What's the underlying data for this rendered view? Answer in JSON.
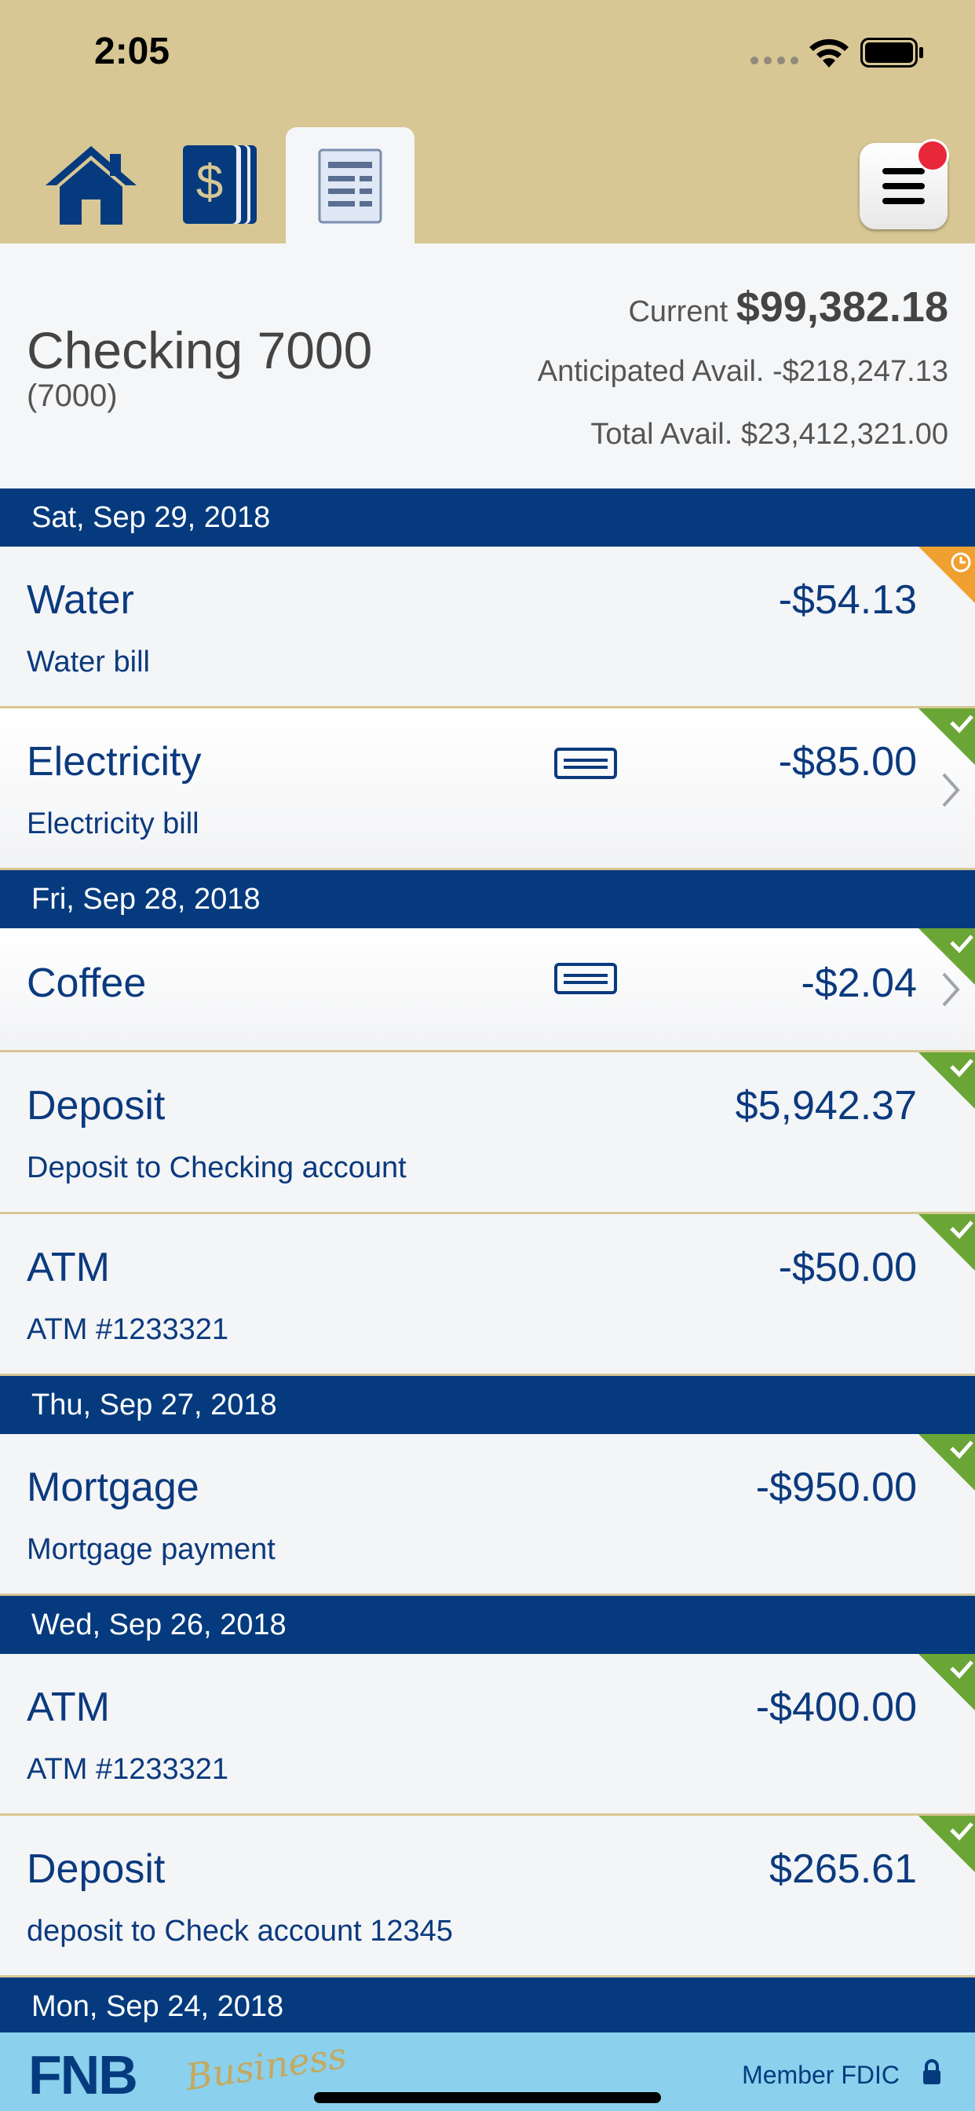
{
  "status_bar": {
    "time": "2:05"
  },
  "nav": {
    "tabs": [
      {
        "name": "home",
        "icon": "house-icon"
      },
      {
        "name": "accounts",
        "icon": "dollar-cards-icon"
      },
      {
        "name": "register",
        "icon": "register-list-icon",
        "selected": true
      }
    ],
    "menu_icon": "hamburger-menu-icon",
    "notification_badge": true
  },
  "account": {
    "name": "Checking 7000",
    "number": "(7000)",
    "current_label": "Current",
    "current_amount": "$99,382.18",
    "anticipated_label": "Anticipated Avail.",
    "anticipated_amount": "-$218,247.13",
    "total_label": "Total Avail.",
    "total_amount": "$23,412,321.00"
  },
  "groups": [
    {
      "date": "Sat, Sep 29, 2018",
      "items": [
        {
          "payee": "Water",
          "memo": "Water bill",
          "amount": "-$54.13",
          "status": "pending",
          "card": false,
          "chevron": false
        },
        {
          "payee": "Electricity",
          "memo": "Electricity bill",
          "amount": "-$85.00",
          "status": "cleared",
          "card": true,
          "chevron": true
        }
      ]
    },
    {
      "date": "Fri, Sep 28, 2018",
      "items": [
        {
          "payee": "Coffee",
          "memo": "",
          "amount": "-$2.04",
          "status": "cleared",
          "card": true,
          "chevron": true
        },
        {
          "payee": "Deposit",
          "memo": "Deposit to Checking account",
          "amount": "$5,942.37",
          "status": "cleared",
          "card": false,
          "chevron": false
        },
        {
          "payee": "ATM",
          "memo": "ATM #1233321",
          "amount": "-$50.00",
          "status": "cleared",
          "card": false,
          "chevron": false
        }
      ]
    },
    {
      "date": "Thu, Sep 27, 2018",
      "items": [
        {
          "payee": "Mortgage",
          "memo": "Mortgage payment",
          "amount": "-$950.00",
          "status": "cleared",
          "card": false,
          "chevron": false
        }
      ]
    },
    {
      "date": "Wed, Sep 26, 2018",
      "items": [
        {
          "payee": "ATM",
          "memo": "ATM #1233321",
          "amount": "-$400.00",
          "status": "cleared",
          "card": false,
          "chevron": false
        },
        {
          "payee": "Deposit",
          "memo": "deposit to Check account 12345",
          "amount": "$265.61",
          "status": "cleared",
          "card": false,
          "chevron": false
        }
      ]
    },
    {
      "date": "Mon, Sep 24, 2018",
      "items": []
    }
  ],
  "footer": {
    "logo_text": "FNB",
    "logo_script": "Business",
    "fdic": "Member FDIC",
    "lock_icon": "lock-icon"
  },
  "colors": {
    "header_gold": "#d8c794",
    "navy": "#053b7e",
    "pending_orange": "#f0a030",
    "cleared_green": "#6aa636",
    "footer_blue": "#8bd0ec"
  }
}
